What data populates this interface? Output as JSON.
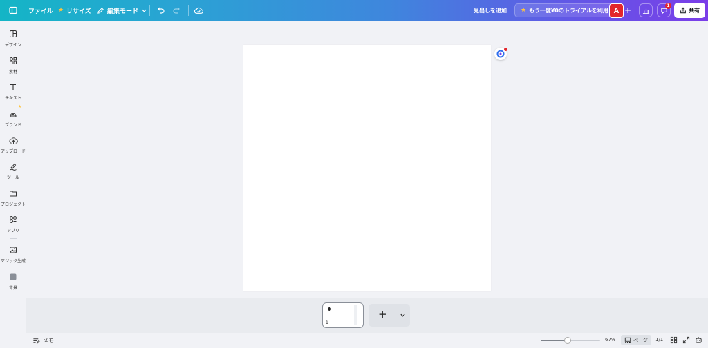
{
  "topbar": {
    "file_label": "ファイル",
    "resize_label": "リサイズ",
    "edit_mode_label": "編集モード",
    "add_heading_label": "見出しを追加",
    "trial_label": "もう一度¥0のトライアルを利用",
    "avatar_initial": "A",
    "notification_count": "1",
    "share_label": "共有"
  },
  "sidebar": {
    "items": [
      {
        "label": "デザイン",
        "icon": "design-icon"
      },
      {
        "label": "素材",
        "icon": "elements-icon"
      },
      {
        "label": "テキスト",
        "icon": "text-icon"
      },
      {
        "label": "ブランド",
        "icon": "brand-icon"
      },
      {
        "label": "アップロード",
        "icon": "upload-icon"
      },
      {
        "label": "ツール",
        "icon": "draw-icon"
      },
      {
        "label": "プロジェクト",
        "icon": "folder-icon"
      },
      {
        "label": "アプリ",
        "icon": "apps-icon"
      },
      {
        "label": "マジック生成",
        "icon": "magic-media-icon"
      },
      {
        "label": "背景",
        "icon": "background-icon"
      }
    ]
  },
  "pages": {
    "thumbnail_number": "1",
    "add_symbol": "+"
  },
  "footer": {
    "memo_label": "メモ",
    "zoom_level": "67%",
    "zoom_fraction": 0.45,
    "page_button_label": "ページ",
    "page_count": "1/1"
  },
  "colors": {
    "accent_start": "#14b5c6",
    "accent_end": "#7a3ee8",
    "avatar_bg": "#e3262d",
    "star": "#ffc53d"
  }
}
